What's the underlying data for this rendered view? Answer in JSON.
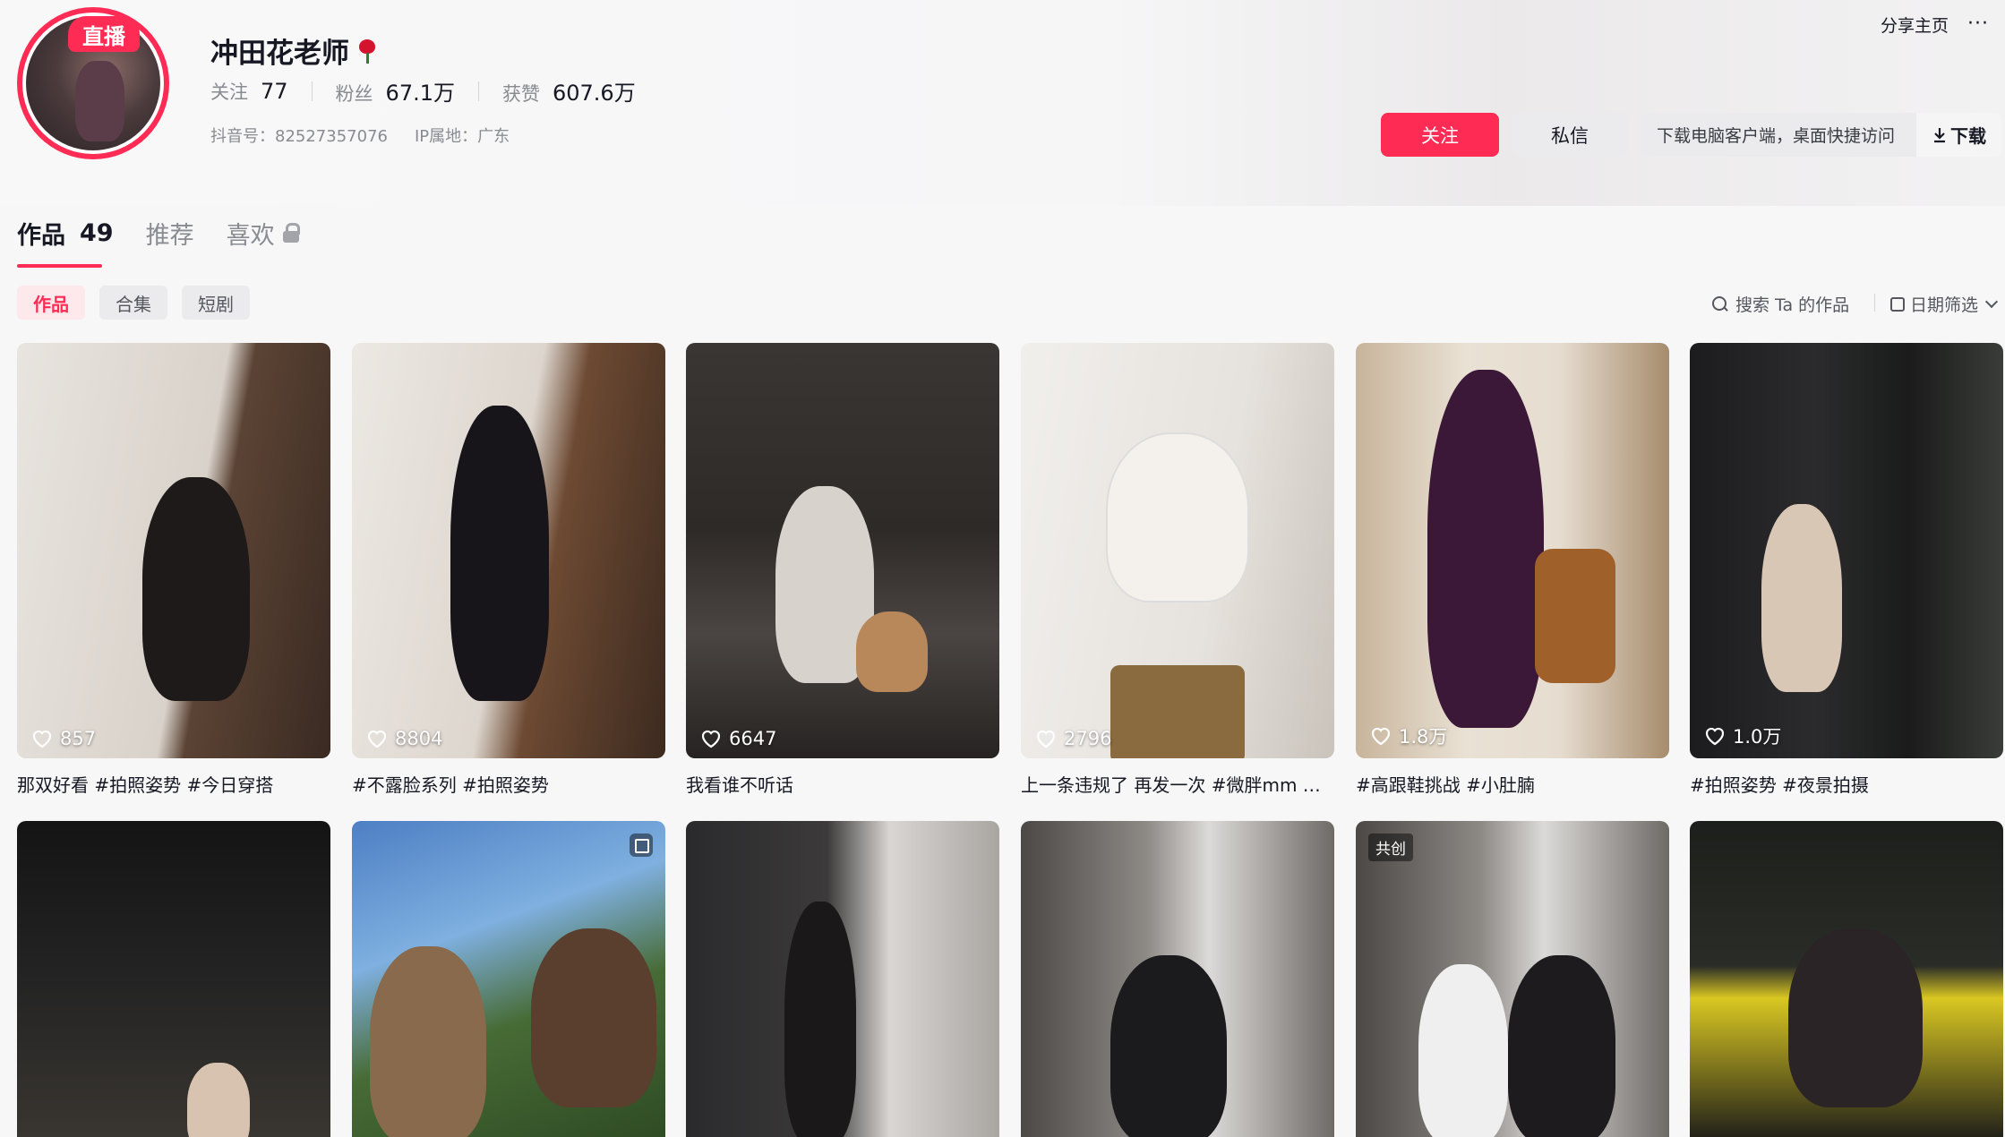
{
  "profile": {
    "live_badge": "直播",
    "name": "冲田花老师",
    "stats": [
      {
        "label": "关注",
        "value": "77"
      },
      {
        "label": "粉丝",
        "value": "67.1万"
      },
      {
        "label": "获赞",
        "value": "607.6万"
      }
    ],
    "douyin_id": "抖音号：82527357076",
    "ip_location": "IP属地：广东"
  },
  "actions": {
    "follow": "关注",
    "message": "私信",
    "download_hint": "下载电脑客户端，桌面快捷访问",
    "download": "下载",
    "share_home": "分享主页",
    "more": "···"
  },
  "tabs": [
    {
      "label": "作品",
      "count": "49"
    },
    {
      "label": "推荐"
    },
    {
      "label": "喜欢"
    }
  ],
  "chips": [
    "作品",
    "合集",
    "短剧"
  ],
  "search_placeholder": "搜索 Ta 的作品",
  "date_filter": "日期筛选",
  "videos_row1": [
    {
      "likes": "857",
      "caption": "那双好看 #拍照姿势 #今日穿搭"
    },
    {
      "likes": "8804",
      "caption": "#不露脸系列 #拍照姿势"
    },
    {
      "likes": "6647",
      "caption": "我看谁不听话"
    },
    {
      "likes": "2796",
      "caption": "上一条违规了 再发一次 #微胖mm #…"
    },
    {
      "likes": "1.8万",
      "caption": "#高跟鞋挑战 #小肚腩"
    },
    {
      "likes": "1.0万",
      "caption": "#拍照姿势 #夜景拍摄"
    }
  ],
  "videos_row2": [
    {
      "badge": ""
    },
    {
      "badge": ""
    },
    {
      "badge": ""
    },
    {
      "badge": ""
    },
    {
      "badge": "共创"
    },
    {
      "badge": ""
    }
  ],
  "colors": {
    "accent": "#fe2c55",
    "text": "#161823",
    "muted": "#8a8b91"
  }
}
